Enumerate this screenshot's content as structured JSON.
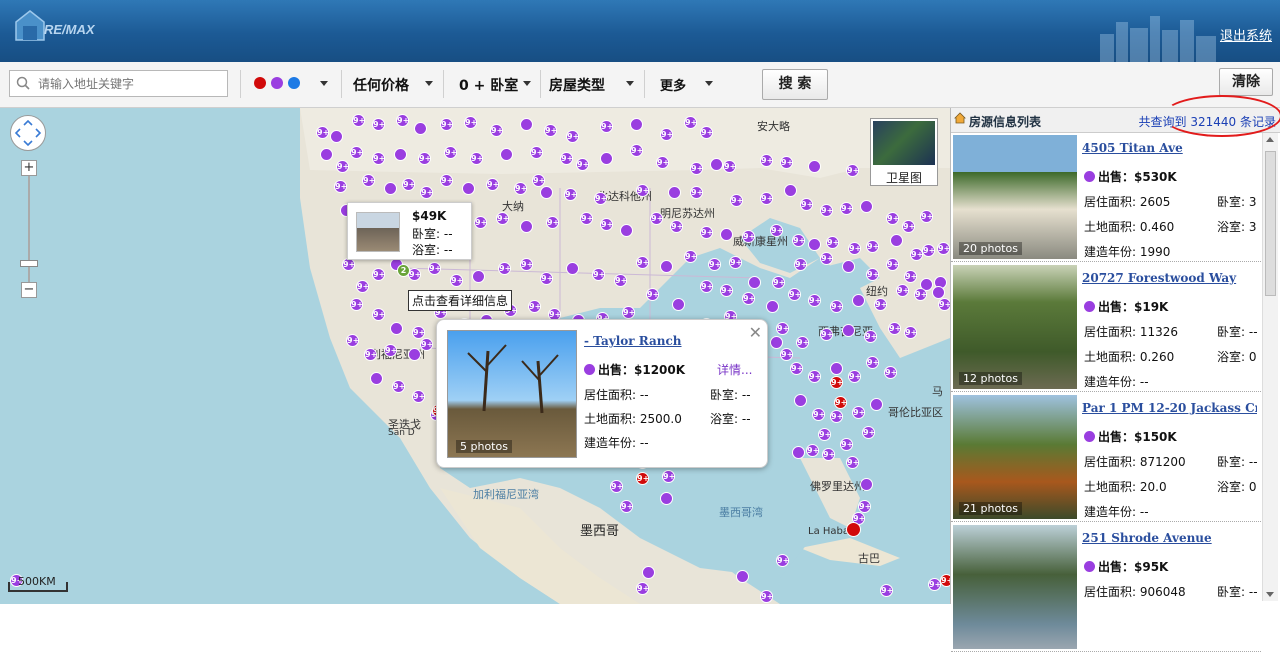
{
  "header": {
    "logo_text": "RE/MAX",
    "logout_label": "退出系统"
  },
  "toolbar": {
    "search_placeholder": "请输入地址关键字",
    "color_dots": [
      "#d10a0a",
      "#9a3ee0",
      "#1d7ae5"
    ],
    "price_label": "任何价格",
    "bedroom_label": "0 + 卧室",
    "type_label": "房屋类型",
    "more_label": "更多",
    "search_button": "搜 索",
    "clear_button": "清除"
  },
  "map": {
    "satellite_label": "卫星图",
    "scale_label": "500KM",
    "labels": {
      "anxiao": "安大略",
      "beidakota": "北达科他州",
      "mingnisuda": "明尼苏达州",
      "weisikang": "威斯康星州",
      "nuoyue": "纽约",
      "xiwenjiqi": "西弗吉尼亚",
      "jiali": "加利福尼亚州",
      "sandiego": "圣迭戈",
      "sandiego_en": "San D",
      "ma": "马",
      "gelunbiya": "哥伦比亚区",
      "baxi": "佛罗里达州",
      "mexicowan": "墨西哥湾",
      "gulf_ca": "加利福尼亚湾",
      "mexico": "墨西哥",
      "lahabana": "La Haban",
      "gubа": "古巴",
      "danawei": "达那",
      "keluo": "堪萨斯",
      "daweiwei": "大纳",
      "jiazhou2": "利福尼亚州",
      "ma2": "马里"
    },
    "mini_popup": {
      "price": "$49K",
      "bedrooms": "卧室: --",
      "baths": "浴室: --"
    },
    "tooltip": "点击查看详细信息",
    "popup": {
      "title": "- Taylor Ranch",
      "sale": "出售：$1200K",
      "detail": "详情...",
      "living": "居住面积: --",
      "bedrooms": "卧室: --",
      "land": "土地面积: 2500.0",
      "baths": "浴室: --",
      "year": "建造年份: --",
      "photos": "5 photos"
    }
  },
  "sidebar": {
    "title": "房源信息列表",
    "total_prefix": "共查询到",
    "total_count": "321440",
    "total_suffix": "条记录",
    "listings": [
      {
        "address": "4505 Titan Ave",
        "sale": "出售：$530K",
        "living": "居住面积: 2605",
        "bedrooms": "卧室: 3",
        "land": "土地面积: 0.460",
        "baths": "浴室: 3",
        "year": "建造年份: 1990",
        "photos": "20 photos"
      },
      {
        "address": "20727 Forestwood Way",
        "sale": "出售：$19K",
        "living": "居住面积: 11326",
        "bedrooms": "卧室: --",
        "land": "土地面积: 0.260",
        "baths": "浴室: 0",
        "year": "建造年份: --",
        "photos": "12 photos"
      },
      {
        "address": "Par 1 PM 12-20 Jackass Creek ...",
        "sale": "出售：$150K",
        "living": "居住面积: 871200",
        "bedrooms": "卧室: --",
        "land": "土地面积: 20.0",
        "baths": "浴室: 0",
        "year": "建造年份: --",
        "photos": "21 photos"
      },
      {
        "address": "251 Shrode Avenue",
        "sale": "出售：$95K",
        "living": "居住面积: 906048",
        "bedrooms": "卧室: --",
        "land": "",
        "baths": "",
        "year": "",
        "photos": ""
      }
    ]
  },
  "marker_text": "9+"
}
